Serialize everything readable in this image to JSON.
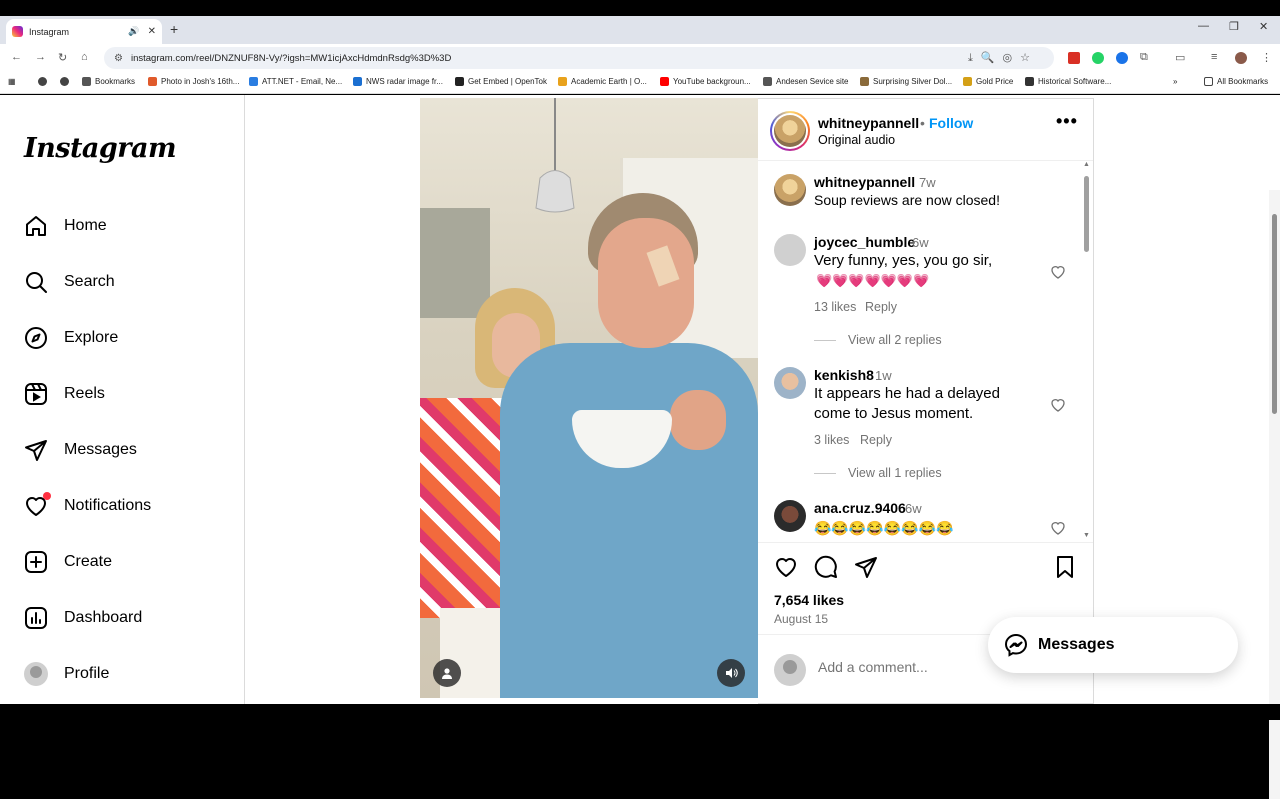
{
  "browser": {
    "tab_title": "Instagram",
    "new_tab": "+",
    "url": "instagram.com/reel/DNZNUF8N-Vy/?igsh=MW1icjAxcHdmdnRsdg%3D%3D",
    "bookmarks": [
      {
        "label": "Bookmarks",
        "color": "#555555"
      },
      {
        "label": "Photo in Josh's 16th...",
        "color": "#e05a2b"
      },
      {
        "label": "ATT.NET - Email, Ne...",
        "color": "#2a7de1"
      },
      {
        "label": "NWS radar image fr...",
        "color": "#1b6fd1"
      },
      {
        "label": "Get Embed | OpenTok",
        "color": "#222222"
      },
      {
        "label": "Academic Earth | O...",
        "color": "#e8a21c"
      },
      {
        "label": "YouTube backgroun...",
        "color": "#ff0000"
      },
      {
        "label": "Andesen Sevice site",
        "color": "#555555"
      },
      {
        "label": "Surprising Silver Dol...",
        "color": "#8a6a3a"
      },
      {
        "label": "Gold Price",
        "color": "#d4a017"
      },
      {
        "label": "Historical Software...",
        "color": "#333333"
      }
    ],
    "all_bookmarks": "All Bookmarks"
  },
  "sidebar": {
    "logo": "Instagram",
    "items": [
      {
        "label": "Home",
        "icon": "home-icon"
      },
      {
        "label": "Search",
        "icon": "search-icon"
      },
      {
        "label": "Explore",
        "icon": "compass-icon"
      },
      {
        "label": "Reels",
        "icon": "reels-icon"
      },
      {
        "label": "Messages",
        "icon": "send-icon"
      },
      {
        "label": "Notifications",
        "icon": "heart-icon"
      },
      {
        "label": "Create",
        "icon": "plus-square-icon"
      },
      {
        "label": "Dashboard",
        "icon": "dashboard-icon"
      },
      {
        "label": "Profile",
        "icon": "avatar-icon"
      }
    ]
  },
  "post": {
    "username": "whitneypannell",
    "dot": "•",
    "follow": "Follow",
    "audio": "Original audio",
    "more": "•••",
    "comments": [
      {
        "user": "whitneypannell",
        "time": "7w",
        "text": "Soup reviews are now closed!"
      },
      {
        "user": "joycec_humble",
        "time": "6w",
        "text": "Very funny, yes, you go sir,",
        "hearts": "💗💗💗💗💗💗💗",
        "likes": "13 likes",
        "reply": "Reply",
        "view_replies": "View all 2 replies"
      },
      {
        "user": "kenkish8",
        "time": "1w",
        "text": "It appears he had a delayed come to Jesus moment.",
        "likes": "3 likes",
        "reply": "Reply",
        "view_replies": "View all 1 replies"
      },
      {
        "user": "ana.cruz.9406",
        "time": "6w",
        "text": "😂😂😂😂😂😂😂😂"
      }
    ],
    "likes": "7,654 likes",
    "date": "August 15",
    "add_comment_placeholder": "Add a comment..."
  },
  "messages_pill": "Messages",
  "colors": {
    "accent": "#0095f6",
    "notification": "#ff3040"
  }
}
